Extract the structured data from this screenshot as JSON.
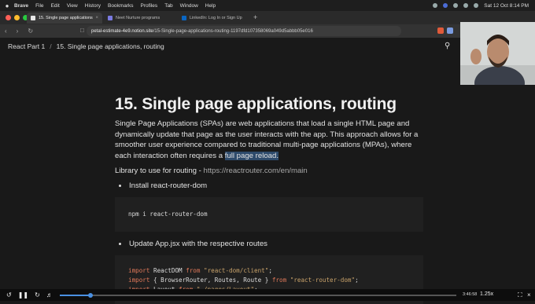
{
  "menubar": {
    "apple": "",
    "app_name": "Brave",
    "menus": [
      "File",
      "Edit",
      "View",
      "History",
      "Bookmarks",
      "Profiles",
      "Tab",
      "Window",
      "Help"
    ],
    "datetime": "Sat 12 Oct 8:14 PM"
  },
  "tabs": [
    {
      "label": "15. Single page applications",
      "active": true,
      "favicon_color": "#e6e6e6"
    },
    {
      "label": "Neet Nurture programs",
      "active": false,
      "favicon_color": "#7a7ae0"
    },
    {
      "label": "LinkedIn: Log In or Sign Up",
      "active": false,
      "favicon_color": "#0a66c2"
    }
  ],
  "new_tab": "+",
  "address": {
    "host": "petal-estimate-4e9.notion.site",
    "path": "/15-Single-page-applications-routing-1197dfd107358069a049d5abbb05e016"
  },
  "breadcrumb": {
    "parent": "React Part 1",
    "sep": "/",
    "current": "15. Single page applications, routing"
  },
  "page": {
    "title": "15. Single page applications, routing",
    "intro_before": "Single Page Applications (SPAs) are web applications that load a single HTML page and dynamically update that page as the user interacts with the app. This approach allows for a smoother user experience compared to traditional multi-page applications (MPAs), where each interaction often requires a ",
    "intro_highlight": "full page reload.",
    "library_label": "Library to use for routing - ",
    "library_link": "https://reactrouter.com/en/main",
    "bullet1": "Install react-router-dom",
    "code1": "npm i react-router-dom",
    "bullet2": "Update App.jsx with the respective routes",
    "code2": [
      {
        "kw": "import",
        "mid": " ReactDOM ",
        "kw2": "from",
        "str": " \"react-dom/client\"",
        "end": ";"
      },
      {
        "kw": "import",
        "mid": " { BrowserRouter, Routes, Route } ",
        "kw2": "from",
        "str": " \"react-router-dom\"",
        "end": ";"
      },
      {
        "kw": "import",
        "mid": " Layout ",
        "kw2": "from",
        "str": " \"./pages/Layout\"",
        "end": ";"
      }
    ]
  },
  "video": {
    "time": "3:46:58",
    "speed": "1.25x",
    "progress": 0.077
  },
  "colors": {
    "accent": "#4a90e2",
    "highlight": "#2d4a6b",
    "keyword": "#e0795a",
    "string": "#c8a26a"
  }
}
